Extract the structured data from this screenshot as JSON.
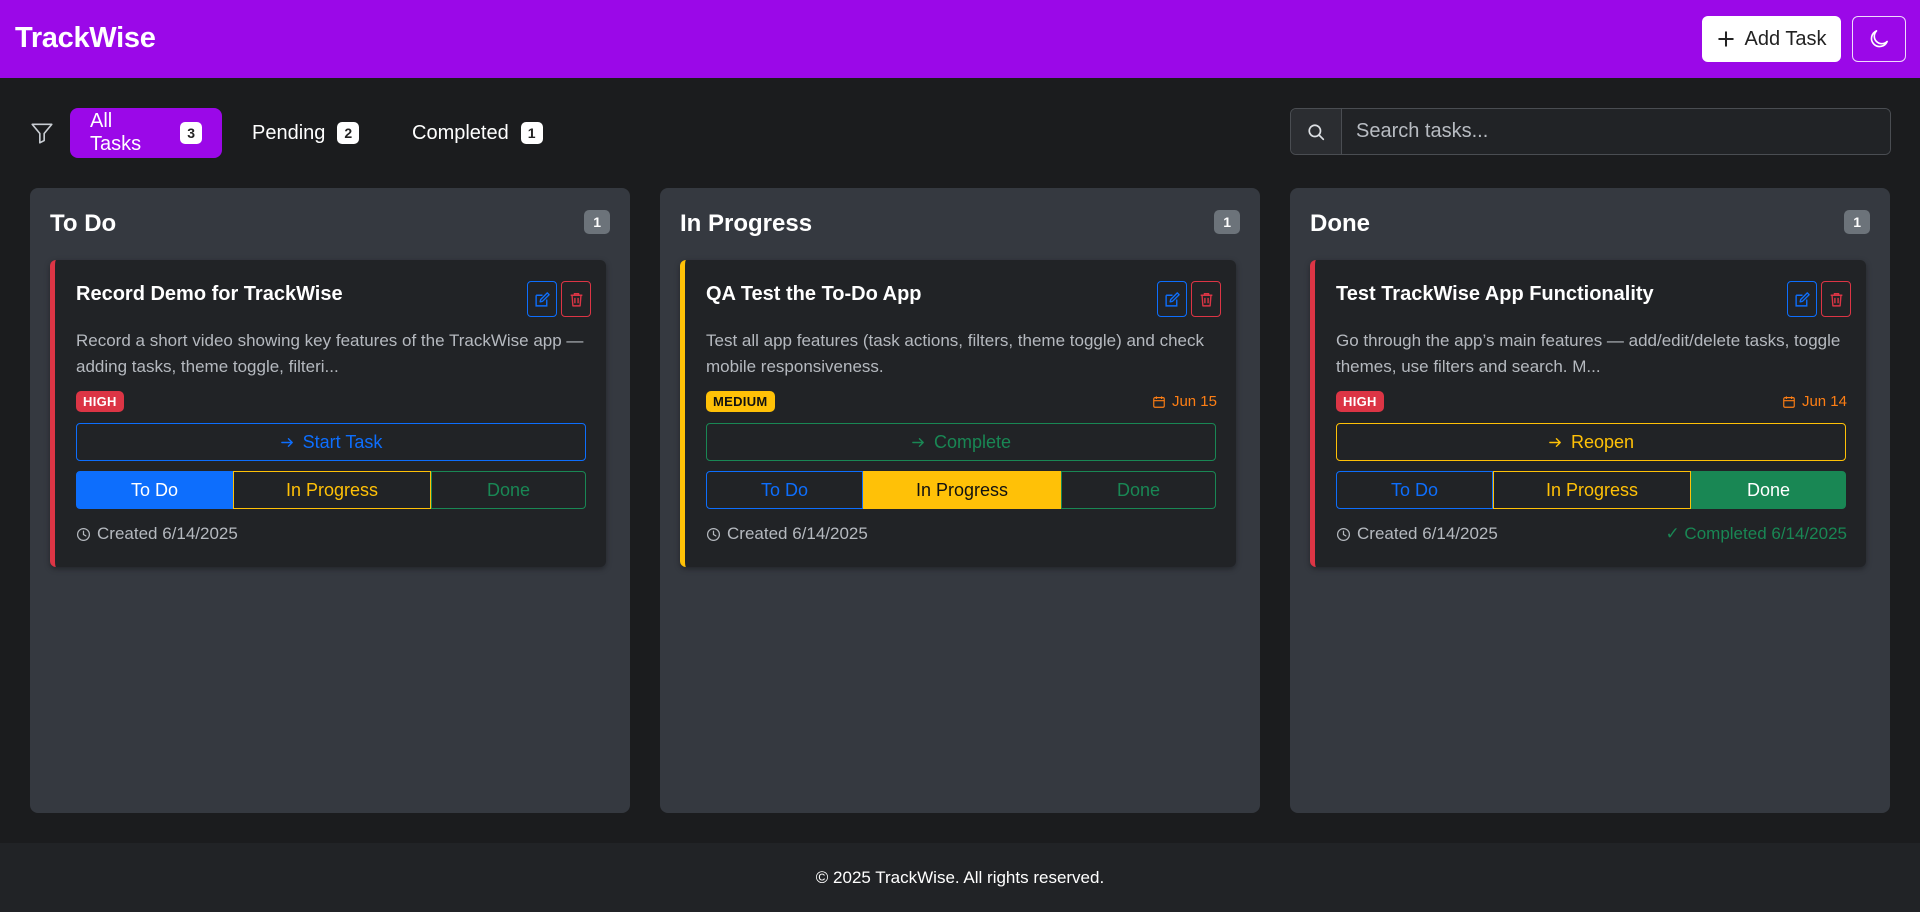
{
  "app": {
    "title": "TrackWise",
    "add_task_label": "Add Task"
  },
  "filters": [
    {
      "label": "All Tasks",
      "count": "3",
      "active": true
    },
    {
      "label": "Pending",
      "count": "2",
      "active": false
    },
    {
      "label": "Completed",
      "count": "1",
      "active": false
    }
  ],
  "search": {
    "placeholder": "Search tasks..."
  },
  "columns": [
    {
      "title": "To Do",
      "count": "1",
      "card": {
        "title": "Record Demo for TrackWise",
        "description": "Record a short video showing key features of the TrackWise app — adding tasks, theme toggle, filteri...",
        "priority": "HIGH",
        "due": "",
        "action": "Start Task",
        "status_labels": [
          "To Do",
          "In Progress",
          "Done"
        ],
        "status": "To Do",
        "created": "Created 6/14/2025",
        "completed": ""
      }
    },
    {
      "title": "In Progress",
      "count": "1",
      "card": {
        "title": "QA Test the To-Do App",
        "description": "Test all app features (task actions, filters, theme toggle) and check mobile responsiveness.",
        "priority": "MEDIUM",
        "due": "Jun 15",
        "action": "Complete",
        "status_labels": [
          "To Do",
          "In Progress",
          "Done"
        ],
        "status": "In Progress",
        "created": "Created 6/14/2025",
        "completed": ""
      }
    },
    {
      "title": "Done",
      "count": "1",
      "card": {
        "title": "Test TrackWise App Functionality",
        "description": "Go through the app’s main features — add/edit/delete tasks, toggle themes, use filters and search. M...",
        "priority": "HIGH",
        "due": "Jun 14",
        "action": "Reopen",
        "status_labels": [
          "To Do",
          "In Progress",
          "Done"
        ],
        "status": "Done",
        "created": "Created 6/14/2025",
        "completed": "✓ Completed 6/14/2025"
      }
    }
  ],
  "footer": {
    "text": "© 2025 TrackWise. All rights reserved."
  },
  "colors": {
    "brand": "#9b08e8",
    "high": "#dc3545",
    "medium": "#ffc107",
    "primary": "#0d6efd",
    "success": "#198754",
    "due": "#fd7e14"
  },
  "icons": {
    "add": "plus-icon",
    "theme": "moon-icon",
    "filter": "filter-icon",
    "search": "search-icon",
    "edit": "edit-icon",
    "delete": "trash-icon",
    "action": "arrow-right-icon",
    "due": "calendar-icon",
    "created": "clock-icon"
  }
}
